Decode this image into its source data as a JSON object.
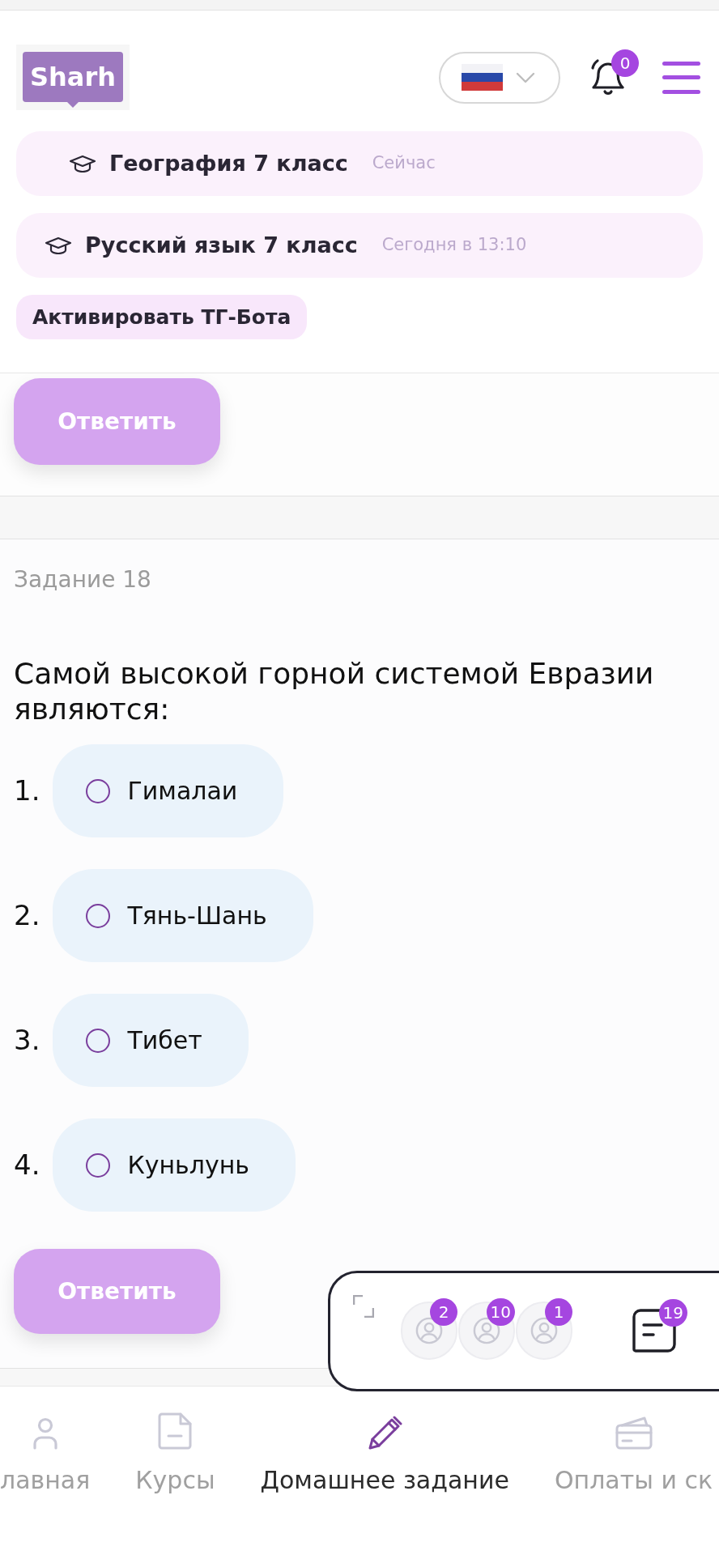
{
  "header": {
    "logo": "Sharh",
    "notifications": {
      "count": "0"
    },
    "lessons": [
      {
        "title": "География 7 класс",
        "time": "Сейчас"
      },
      {
        "title": "Русский язык 7 класс",
        "time": "Сегодня в 13:10"
      }
    ],
    "bot_button": "Активировать ТГ-Бота"
  },
  "previous_task": {
    "answer_button": "Ответить"
  },
  "task": {
    "label": "Задание 18",
    "question": "Самой высокой горной системой Евразии являются:",
    "options": [
      {
        "number": "1.",
        "text": "Гималаи",
        "selected": false
      },
      {
        "number": "2.",
        "text": "Тянь-Шань",
        "selected": false
      },
      {
        "number": "3.",
        "text": "Тибет",
        "selected": false
      },
      {
        "number": "4.",
        "text": "Куньлунь",
        "selected": false
      }
    ],
    "answer_button": "Ответить"
  },
  "chat_widget": {
    "participants": [
      {
        "badge": "2"
      },
      {
        "badge": "10"
      },
      {
        "badge": "1"
      }
    ],
    "messages_badge": "19"
  },
  "bottom_nav": [
    {
      "kind": "home",
      "label": "лавная",
      "selected": false
    },
    {
      "kind": "courses",
      "label": "Курсы",
      "selected": false
    },
    {
      "kind": "homework",
      "label": "Домашнее задание",
      "selected": true
    },
    {
      "kind": "payments",
      "label": "Оплаты и ск",
      "selected": false
    }
  ]
}
